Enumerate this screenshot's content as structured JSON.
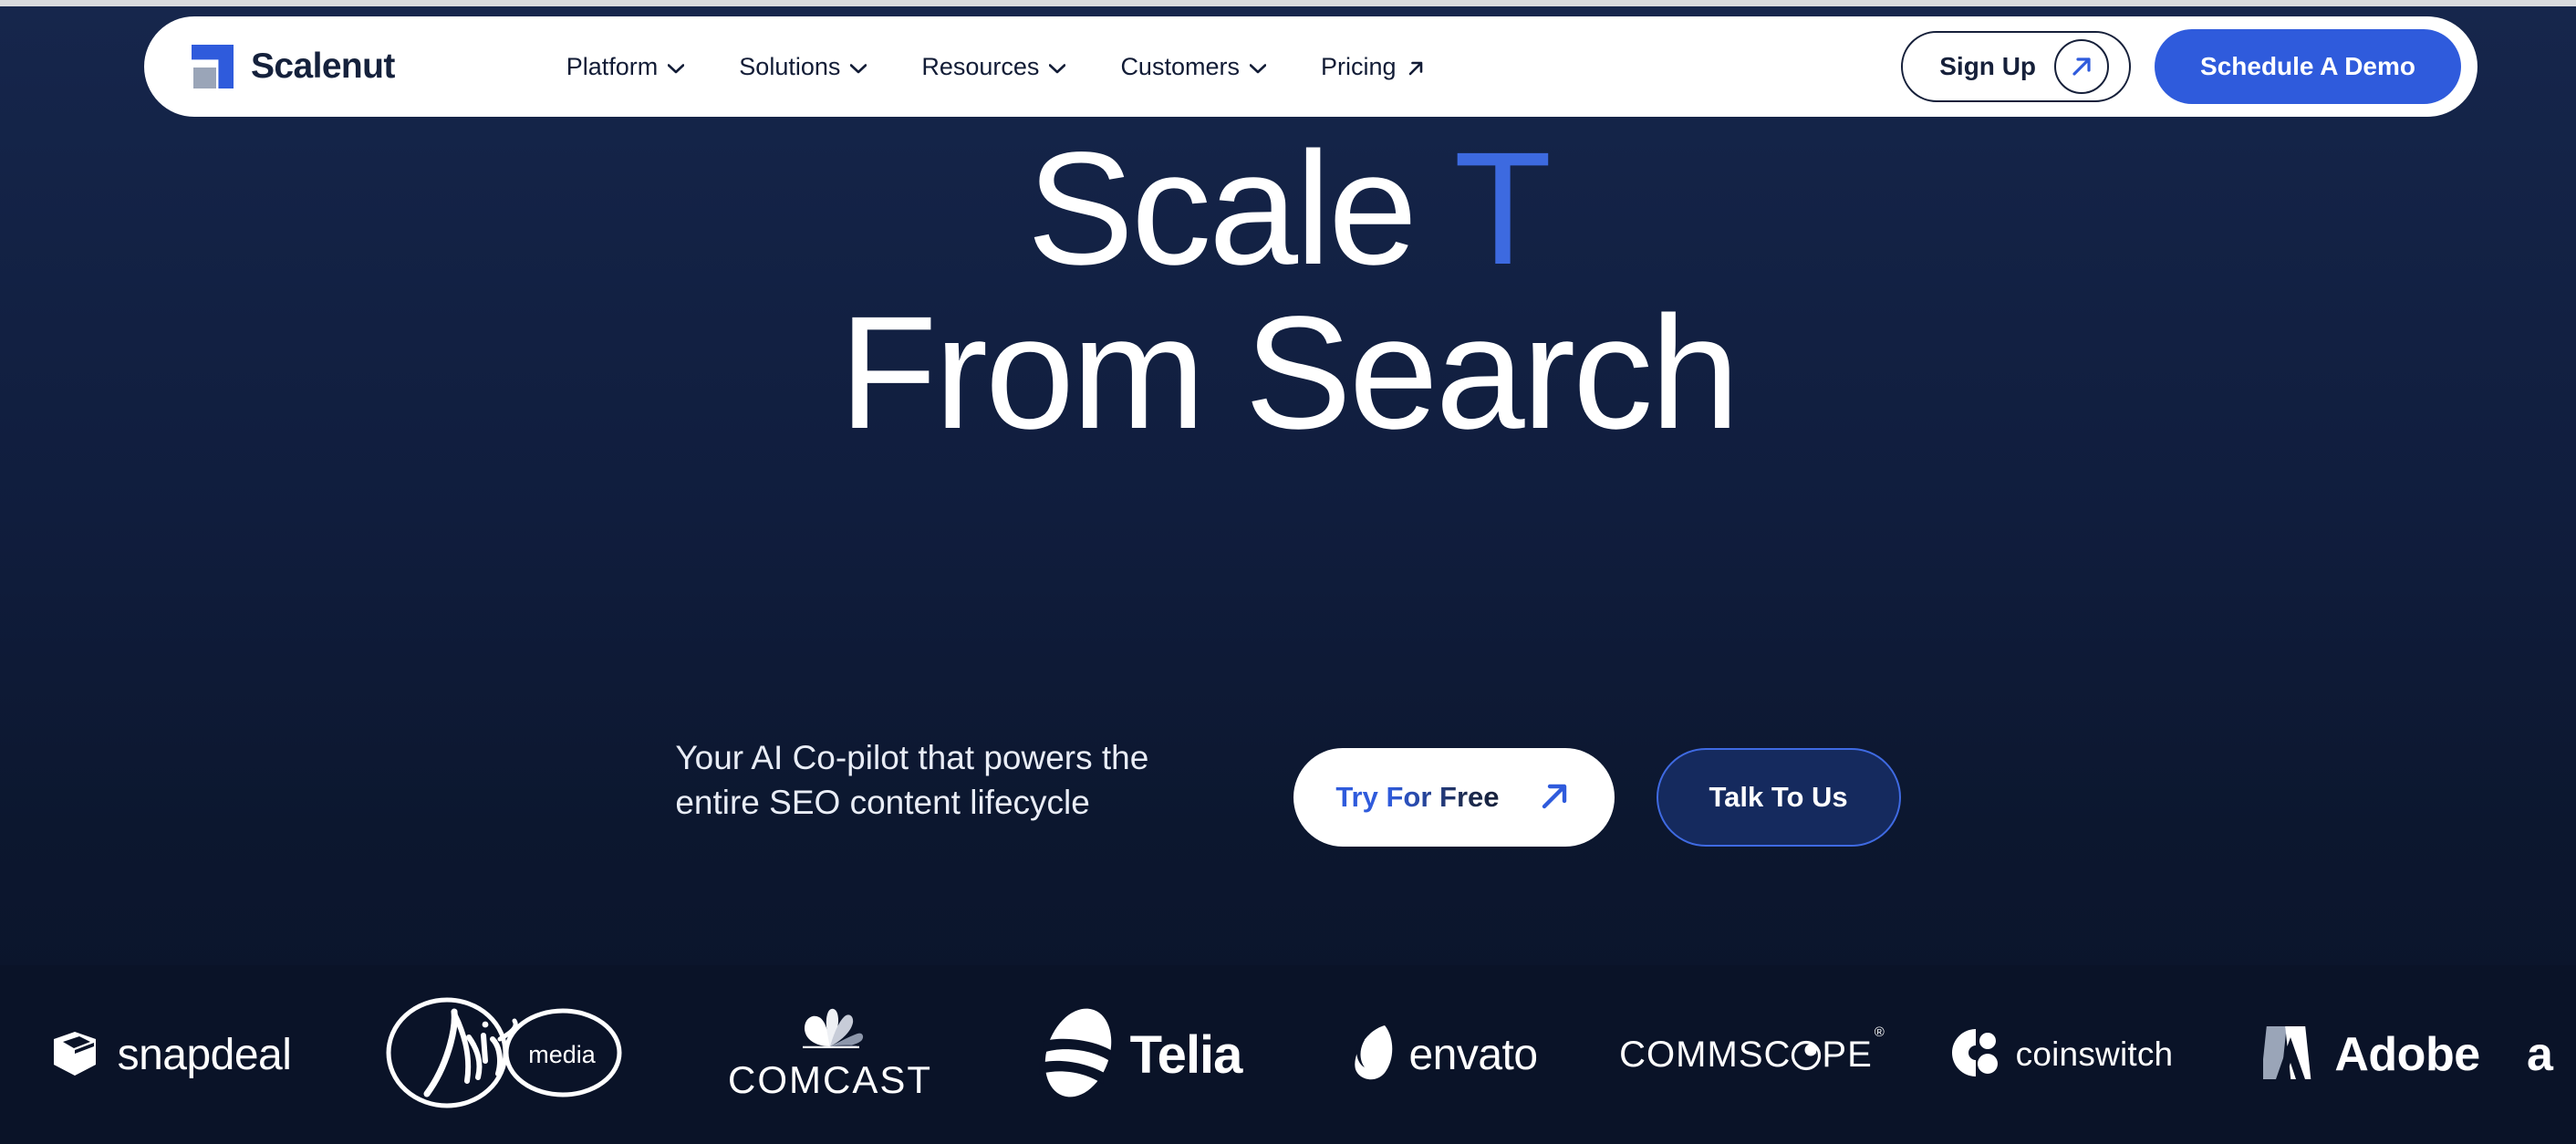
{
  "colors": {
    "accent_blue": "#2f5bdc",
    "typed_blue": "#3d6ae0",
    "bg_top": "#16264c",
    "bg_bottom": "#0a1329",
    "logo_strip_bg": "#0a1328",
    "nav_bg": "#ffffff",
    "nav_text": "#121c36",
    "talk_fill": "#152a5e",
    "talk_border": "#3f6ae2"
  },
  "navbar": {
    "brand_name": "Scalenut",
    "brand_icon": "scalenut-logo-mark",
    "links": [
      {
        "label": "Platform",
        "icon": "chevron-down-icon"
      },
      {
        "label": "Solutions",
        "icon": "chevron-down-icon"
      },
      {
        "label": "Resources",
        "icon": "chevron-down-icon"
      },
      {
        "label": "Customers",
        "icon": "chevron-down-icon"
      },
      {
        "label": "Pricing",
        "icon": "arrow-up-right-icon"
      }
    ],
    "signup_label": "Sign Up",
    "signup_icon": "arrow-up-right-icon",
    "demo_label": "Schedule A Demo"
  },
  "hero": {
    "line1_static": "Scale ",
    "line1_typed": "T",
    "line2": "From Search",
    "subtext": "Your AI Co-pilot that powers the entire SEO content lifecycle",
    "cta_primary_label": "Try For Free",
    "cta_primary_icon": "arrow-up-right-icon",
    "cta_secondary_label": "Talk To Us"
  },
  "logos": [
    {
      "name": "snapdeal",
      "label": "snapdeal",
      "icon": "snapdeal-box-icon"
    },
    {
      "name": "virginmedia",
      "label": "media",
      "icon": "virgin-infinity-icon"
    },
    {
      "name": "comcast",
      "label": "COMCAST",
      "icon": "nbc-peacock-icon"
    },
    {
      "name": "telia",
      "label": "Telia",
      "icon": "telia-swirl-icon"
    },
    {
      "name": "envato",
      "label": "envato",
      "icon": "envato-leaf-icon"
    },
    {
      "name": "commscope",
      "label": "COMMSC",
      "label_tail": "PE",
      "trademark": "®",
      "icon": "commscope-o-icon"
    },
    {
      "name": "coinswitch",
      "label": "coinswitch",
      "icon": "coinswitch-icon"
    },
    {
      "name": "adobe",
      "label": "Adobe",
      "icon": "adobe-a-icon"
    },
    {
      "name": "partial",
      "label": "a",
      "icon": "partial-logo-icon"
    }
  ]
}
